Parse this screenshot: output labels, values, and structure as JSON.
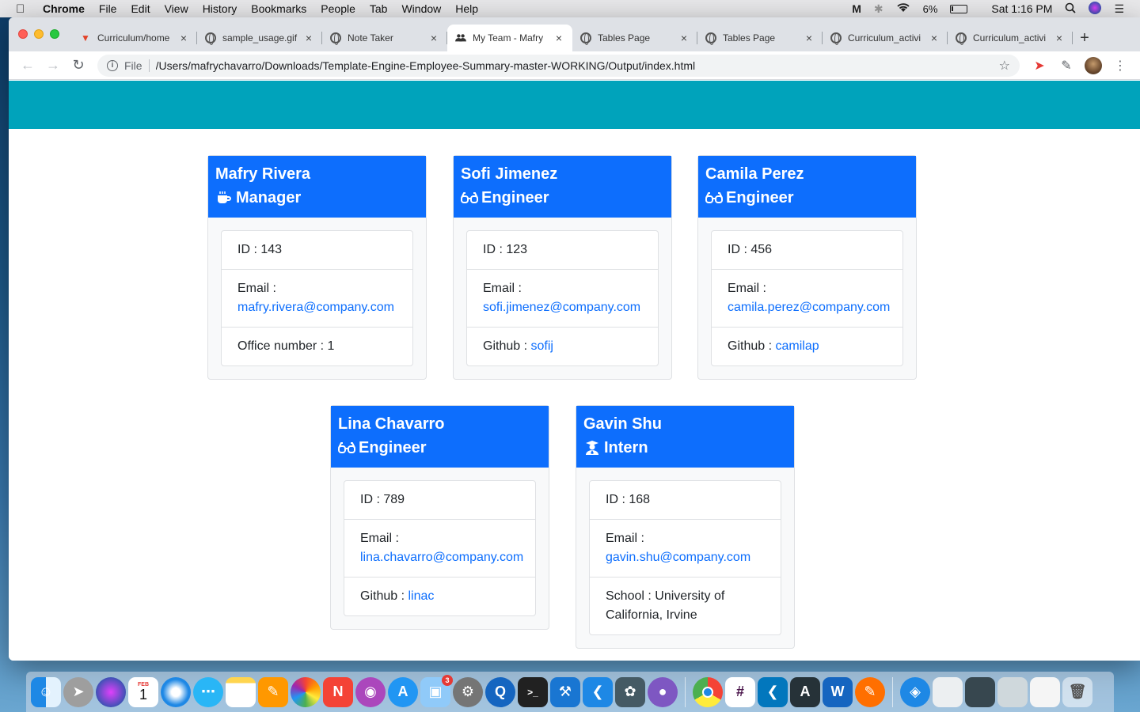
{
  "menubar": {
    "app": "Chrome",
    "items": [
      "File",
      "Edit",
      "View",
      "History",
      "Bookmarks",
      "People",
      "Tab",
      "Window",
      "Help"
    ],
    "battery": "6%",
    "clock": "Sat 1:16 PM"
  },
  "browser": {
    "tabs": [
      {
        "title": "Curriculum/home",
        "icon": "gitlab-icon"
      },
      {
        "title": "sample_usage.gif",
        "icon": "globe-icon"
      },
      {
        "title": "Note Taker",
        "icon": "globe-icon"
      },
      {
        "title": "My Team - Mafry",
        "icon": "team-icon"
      },
      {
        "title": "Tables Page",
        "icon": "globe-icon"
      },
      {
        "title": "Tables Page",
        "icon": "globe-icon"
      },
      {
        "title": "Curriculum_activi",
        "icon": "globe-icon"
      },
      {
        "title": "Curriculum_activi",
        "icon": "globe-icon"
      }
    ],
    "active_tab": 3,
    "address": {
      "scheme_label": "File",
      "url": "/Users/mafrychavarro/Downloads/Template-Engine-Employee-Summary-master-WORKING/Output/index.html"
    }
  },
  "team": [
    {
      "name": "Mafry Rivera",
      "role": "Manager",
      "icon": "coffee-icon",
      "id_label": "ID : 143",
      "email_label": "Email :",
      "email": "mafry.rivera@company.com",
      "extra_label": "Office number : 1",
      "extra_link": ""
    },
    {
      "name": "Sofi Jimenez",
      "role": "Engineer",
      "icon": "glasses-icon",
      "id_label": "ID : 123",
      "email_label": "Email :",
      "email": "sofi.jimenez@company.com",
      "extra_label": "Github : ",
      "extra_link": "sofij"
    },
    {
      "name": "Camila Perez",
      "role": "Engineer",
      "icon": "glasses-icon",
      "id_label": "ID : 456",
      "email_label": "Email :",
      "email": "camila.perez@company.com",
      "extra_label": "Github : ",
      "extra_link": "camilap"
    },
    {
      "name": "Lina Chavarro",
      "role": "Engineer",
      "icon": "glasses-icon",
      "id_label": "ID : 789",
      "email_label": "Email :",
      "email": "lina.chavarro@company.com",
      "extra_label": "Github : ",
      "extra_link": "linac"
    },
    {
      "name": "Gavin Shu",
      "role": "Intern",
      "icon": "graduate-icon",
      "id_label": "ID : 168",
      "email_label": "Email :",
      "email": "gavin.shu@company.com",
      "extra_label": "School : University of California, Irvine",
      "extra_link": ""
    }
  ],
  "colors": {
    "jumbotron": "#00a3bb",
    "card_header": "#0d6efd",
    "link": "#0d6efd"
  },
  "dock": {
    "apps": [
      "Finder",
      "Launchpad",
      "Siri",
      "Calendar",
      "Safari",
      "Messages",
      "Notes",
      "Pages",
      "Photos",
      "News",
      "Podcasts",
      "App Store",
      "Preview",
      "System Preferences",
      "QuickTime",
      "Terminal",
      "Xcode",
      "VS Code",
      "MySQL Workbench",
      "GitHub Desktop",
      "Chrome",
      "Slack",
      "VS Code Insiders",
      "Instruments",
      "Word",
      "Postman",
      "Network",
      "Trash"
    ],
    "calendar_month": "FEB",
    "calendar_day": "1",
    "preview_badge": "3"
  }
}
